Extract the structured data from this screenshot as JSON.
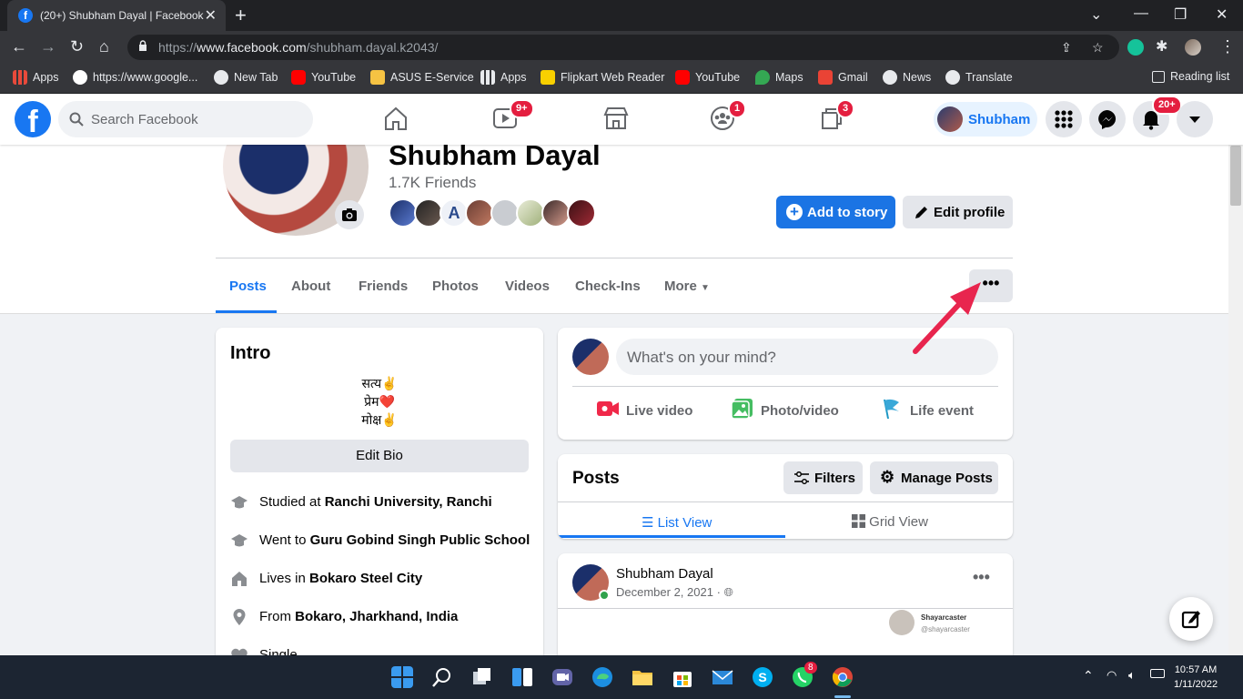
{
  "browser": {
    "tab_title": "(20+) Shubham Dayal | Facebook",
    "url_prefix": "https://",
    "url_host": "www.facebook.com",
    "url_path": "/shubham.dayal.k2043/",
    "bookmarks": [
      "Apps",
      "https://www.google...",
      "New Tab",
      "YouTube",
      "ASUS E-Service",
      "Apps",
      "Flipkart Web Reader",
      "YouTube",
      "Maps",
      "Gmail",
      "News",
      "Translate"
    ],
    "reading_list": "Reading list"
  },
  "fb_header": {
    "search_placeholder": "Search Facebook",
    "watch_badge": "9+",
    "groups_badge": "1",
    "gaming_badge": "3",
    "profile_name": "Shubham",
    "notifications_badge": "20+"
  },
  "profile": {
    "name": "Shubham Dayal",
    "friends_count": "1.7K Friends",
    "add_story": "Add to story",
    "edit_profile": "Edit profile",
    "tabs": [
      "Posts",
      "About",
      "Friends",
      "Photos",
      "Videos",
      "Check-Ins",
      "More"
    ],
    "more_options": "•••"
  },
  "intro": {
    "title": "Intro",
    "bio_lines": [
      "सत्य✌️",
      "प्रेम❤️",
      "मोक्ष✌️"
    ],
    "edit_bio": "Edit Bio",
    "rows": [
      {
        "prefix": "Studied at ",
        "bold": "Ranchi University, Ranchi"
      },
      {
        "prefix": "Went to ",
        "bold": "Guru Gobind Singh Public School"
      },
      {
        "prefix": "Lives in ",
        "bold": "Bokaro Steel City"
      },
      {
        "prefix": "From ",
        "bold": "Bokaro, Jharkhand, India"
      },
      {
        "prefix": "Single",
        "bold": ""
      }
    ]
  },
  "composer": {
    "placeholder": "What's on your mind?",
    "live_video": "Live video",
    "photo_video": "Photo/video",
    "life_event": "Life event"
  },
  "posts_box": {
    "title": "Posts",
    "filters": "Filters",
    "manage_posts": "Manage Posts",
    "list_view": "List View",
    "grid_view": "Grid View"
  },
  "post": {
    "author": "Shubham Dayal",
    "date": "December 2, 2021 · ",
    "shared_name": "Shayarcaster",
    "shared_handle": "@shayarcaster"
  },
  "taskbar": {
    "whatsapp_badge": "8",
    "time": "10:57 AM",
    "date": "1/11/2022"
  },
  "colors": {
    "fb_blue": "#1877f2",
    "badge_red": "#e41e3f",
    "arrow_red": "#e8254e"
  }
}
